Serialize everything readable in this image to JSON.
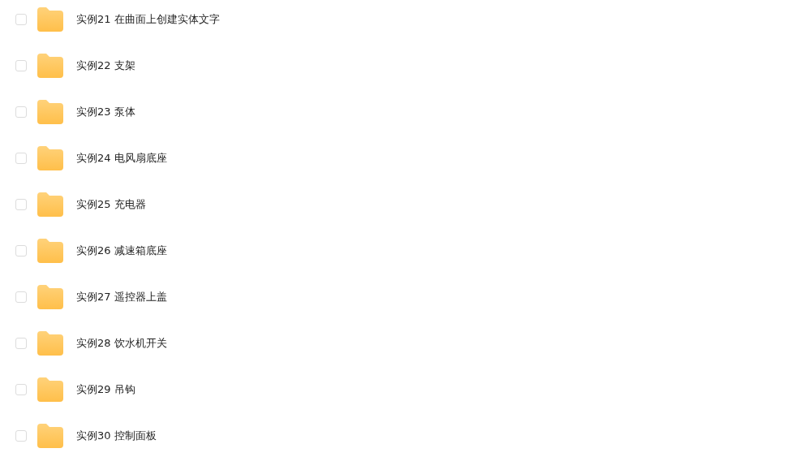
{
  "files": [
    {
      "name": "实例21 在曲面上创建实体文字",
      "checked": false
    },
    {
      "name": "实例22 支架",
      "checked": false
    },
    {
      "name": "实例23 泵体",
      "checked": false
    },
    {
      "name": "实例24 电风扇底座",
      "checked": false
    },
    {
      "name": "实例25 充电器",
      "checked": false
    },
    {
      "name": "实例26 减速箱底座",
      "checked": false
    },
    {
      "name": "实例27 遥控器上盖",
      "checked": false
    },
    {
      "name": "实例28 饮水机开关",
      "checked": false
    },
    {
      "name": "实例29 吊钩",
      "checked": false
    },
    {
      "name": "实例30 控制面板",
      "checked": false
    }
  ]
}
